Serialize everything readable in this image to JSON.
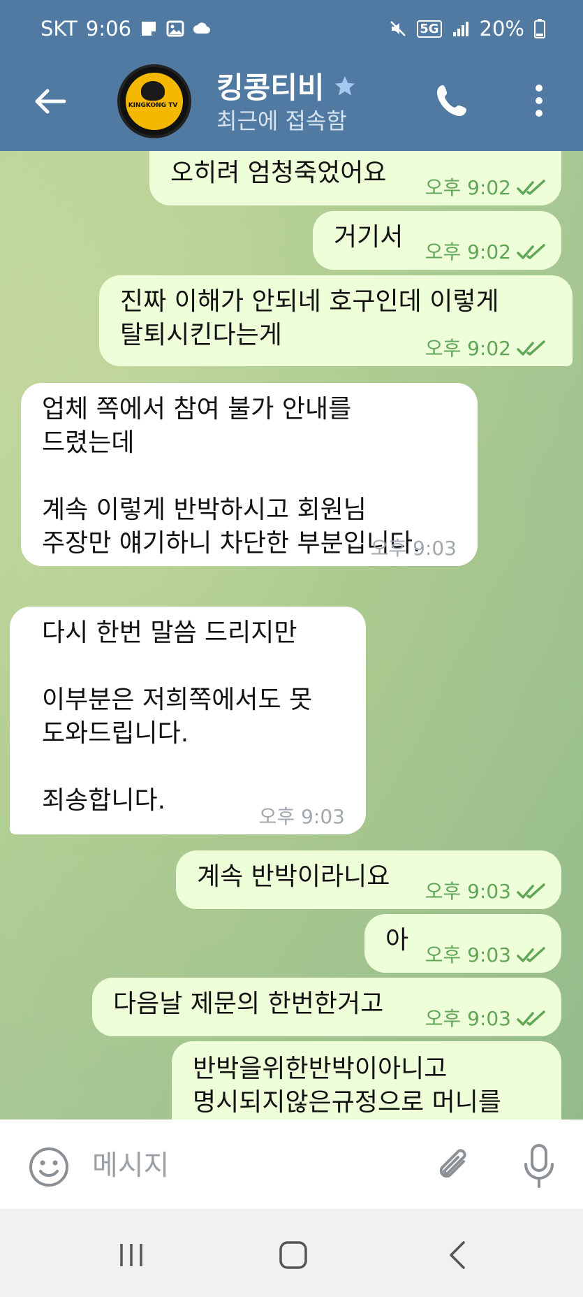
{
  "status_bar": {
    "carrier": "SKT",
    "time": "9:06",
    "network": "5G",
    "battery": "20%"
  },
  "header": {
    "title": "킹콩티비",
    "logo_text": "KINGKONG TV",
    "status": "최근에 접속함"
  },
  "messages": [
    {
      "direction": "out",
      "text": "오히려 엄청죽었어요",
      "time": "오후 9:02",
      "read": true
    },
    {
      "direction": "out",
      "text": "거기서",
      "time": "오후 9:02",
      "read": true
    },
    {
      "direction": "out",
      "text": "진짜 이해가 안되네 호구인데 이렇게\n탈퇴시킨다는게",
      "time": "오후 9:02",
      "read": true
    },
    {
      "direction": "in",
      "text": "업체 쪽에서 참여 불가 안내를\n드렸는데\n\n계속 이렇게 반박하시고 회원님\n주장만 얘기하니 차단한 부분입니다.",
      "time": "오후 9:03"
    },
    {
      "direction": "in",
      "text": "다시 한번 말씀 드리지만\n\n이부분은 저희쪽에서도 못\n도와드립니다.\n\n죄송합니다.",
      "time": "오후 9:03"
    },
    {
      "direction": "out",
      "text": "계속 반박이라니요",
      "time": "오후 9:03",
      "read": true
    },
    {
      "direction": "out",
      "text": "아",
      "time": "오후 9:03",
      "read": true
    },
    {
      "direction": "out",
      "text": "다음날 제문의 한번한거고",
      "time": "오후 9:03",
      "read": true
    },
    {
      "direction": "out",
      "text": "반박을위한반박이아니고\n명시되지않은규정으로 머니를",
      "time": "",
      "read": false
    }
  ],
  "input": {
    "placeholder": "메시지"
  },
  "colors": {
    "header_bg": "#507aa2",
    "outgoing_bubble": "#eefed9",
    "incoming_bubble": "#ffffff",
    "outgoing_meta": "#5fa657"
  },
  "icons": {
    "back": "arrow-left-icon",
    "star": "star-icon",
    "call": "phone-icon",
    "menu": "more-vertical-icon",
    "emoji": "smiley-icon",
    "attach": "paperclip-icon",
    "mic": "microphone-icon"
  }
}
